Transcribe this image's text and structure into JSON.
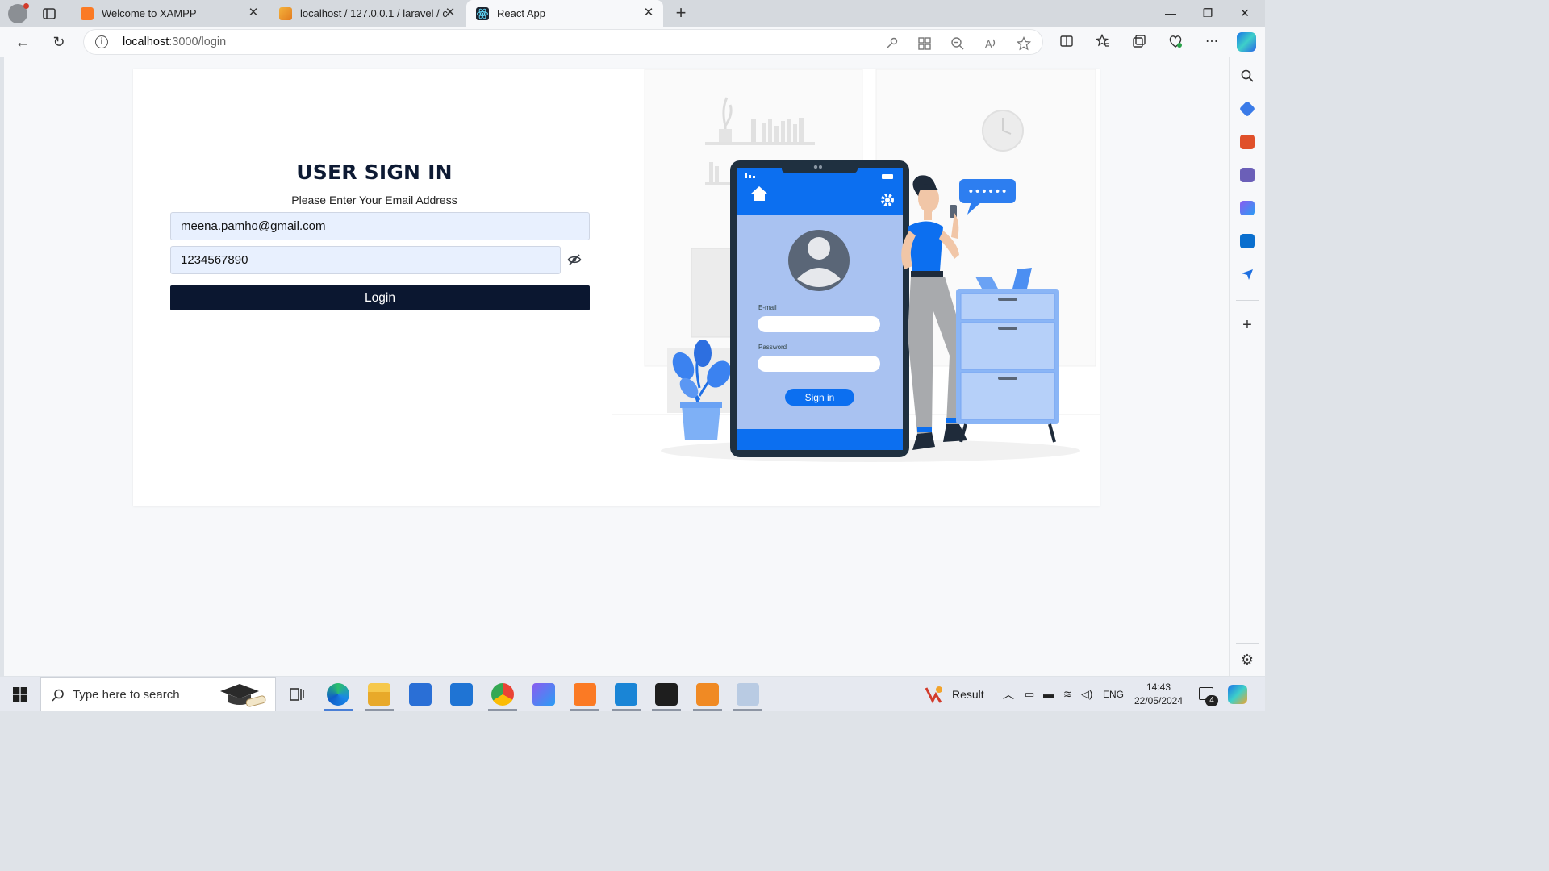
{
  "browser": {
    "tabs": [
      {
        "title": "Welcome to XAMPP",
        "favicon": "xampp-icon",
        "active": false
      },
      {
        "title": "localhost / 127.0.0.1 / laravel / co",
        "favicon": "phpmyadmin-icon",
        "active": false
      },
      {
        "title": "React App",
        "favicon": "react-icon",
        "active": true
      }
    ],
    "url_host": "localhost",
    "url_path": ":3000/login"
  },
  "page": {
    "title": "USER SIGN IN",
    "subtitle": "Please Enter Your Email Address",
    "email_value": "meena.pamho@gmail.com",
    "password_value": "1234567890",
    "login_label": "Login",
    "illustration": {
      "email_label": "E-mail",
      "password_label": "Password",
      "signin_label": "Sign in",
      "chat_text": "••••••"
    }
  },
  "taskbar": {
    "search_placeholder": "Type here to search",
    "weather_label": "Result",
    "language": "ENG",
    "time": "14:43",
    "date": "22/05/2024",
    "notification_count": "4"
  },
  "colors": {
    "accent": "#0c6ff0",
    "button_dark": "#0b1730",
    "input_bg": "#e8f0fe"
  }
}
